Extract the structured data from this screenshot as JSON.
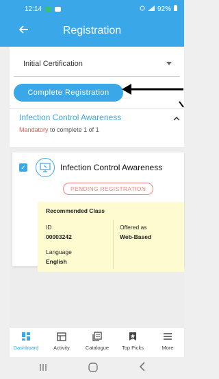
{
  "status_bar": {
    "time": "12:14",
    "battery": "92%"
  },
  "app_bar": {
    "title": "Registration",
    "back_icon": "arrow-left-icon"
  },
  "dropdown": {
    "selected": "Initial Certification"
  },
  "complete_button": {
    "label": "Complete Registration"
  },
  "course_section": {
    "title": "Infection Control Awareness",
    "mandatory_label": "Mandatory",
    "mandatory_rest": "to complete 1 of 1"
  },
  "course_card": {
    "checked": true,
    "title": "Infection Control Awareness",
    "badge": "PENDING REGISTRATION",
    "recommended_label": "Recommended Class",
    "id_label": "ID",
    "id_value": "00003242",
    "offered_label": "Offered as",
    "offered_value": "Web-Based",
    "language_label": "Language",
    "language_value": "English"
  },
  "bottom_nav": {
    "items": [
      {
        "label": "Dashboard",
        "icon": "dashboard-icon",
        "active": true
      },
      {
        "label": "Activity",
        "icon": "calendar-icon",
        "active": false
      },
      {
        "label": "Catalogue",
        "icon": "catalogue-icon",
        "active": false
      },
      {
        "label": "Top Picks",
        "icon": "star-icon",
        "active": false
      },
      {
        "label": "More",
        "icon": "menu-icon",
        "active": false
      }
    ]
  },
  "colors": {
    "brand_blue": "#3aa8e8",
    "mandatory_red": "#e65959",
    "pending_red": "#f08080",
    "info_yellow": "#fdfbcf"
  }
}
